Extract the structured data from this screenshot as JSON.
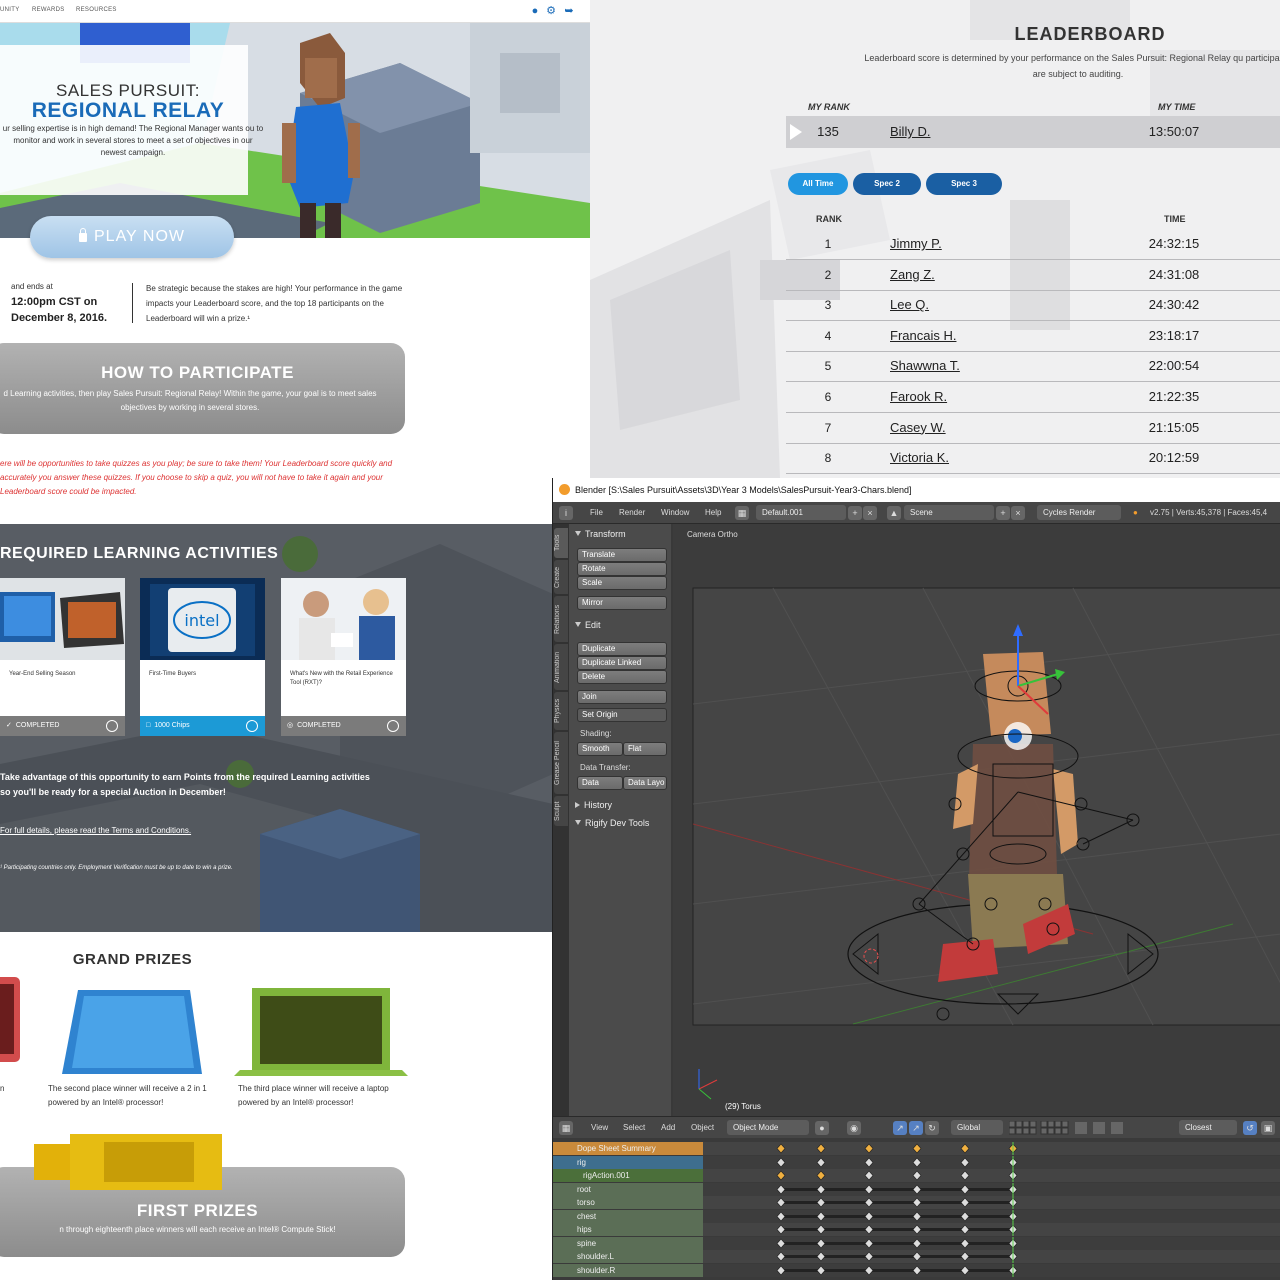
{
  "campaign": {
    "nav": {
      "items": [
        "UNITY",
        "REWARDS",
        "RESOURCES"
      ]
    },
    "hero": {
      "title_line1": "SALES PURSUIT:",
      "title_line2": "REGIONAL RELAY",
      "description": "ur selling expertise is in high demand! The Regional Manager wants ou to monitor and work in several stores to meet a set of objectives in our newest campaign.",
      "play_label": "PLAY NOW"
    },
    "schedule": {
      "prefix": "and ends at",
      "time": "12:00pm CST on",
      "date": "December 8, 2016.",
      "strategic": "Be strategic because the stakes are high! Your performance in the game impacts your Leaderboard score, and the top 18 participants on the Leaderboard will win a prize.¹"
    },
    "how_to": {
      "title": "HOW TO PARTICIPATE",
      "description": "d Learning activities, then play Sales Pursuit: Regional Relay! Within the game, your goal is to meet sales objectives by working in several stores."
    },
    "quiz_note": "ere will be opportunities to take quizzes as you play; be sure to take them! Your Leaderboard score quickly and accurately you answer these quizzes. If you choose to skip a quiz, you will not have to take it again and your Leaderboard score could be impacted.",
    "required": {
      "title": "REQUIRED LEARNING ACTIVITIES",
      "cards": [
        {
          "label": "Year-End Selling Season",
          "status": "COMPLETED",
          "color": "#7b7b7b"
        },
        {
          "label": "First-Time Buyers",
          "status": "1000 Chips",
          "color": "#1c9ad6"
        },
        {
          "label": "What's New with the Retail Experience Tool (RXT)?",
          "status": "COMPLETED",
          "color": "#7b7b7b"
        }
      ],
      "intel_logo_text": "intel",
      "advantage": "Take advantage of this opportunity to earn Points from the required Learning activities so you'll be ready for a special Auction in December!",
      "terms": "For full details, please read the Terms and Conditions.",
      "participating": "¹ Participating countries only. Employment Verification must be up to date to win a prize."
    },
    "prizes": {
      "grand_title": "GRAND PRIZES",
      "first_partial": "n",
      "second": "The second place winner will receive a 2 in 1 powered by an Intel® processor!",
      "third": "The third place winner will receive a laptop powered by an Intel® processor!",
      "first_title": "FIRST PRIZES",
      "first_desc": "n through eighteenth place winners will each receive an Intel® Compute Stick!"
    }
  },
  "leaderboard": {
    "title": "LEADERBOARD",
    "description": "Leaderboard score is determined by your performance on the Sales Pursuit: Regional Relay qu participants are subject to auditing.",
    "my_rank_label": "MY RANK",
    "my_time_label": "MY TIME",
    "me": {
      "rank": "135",
      "name": "Billy D.",
      "time": "13:50:07"
    },
    "filters": [
      {
        "label": "All Time",
        "color": "#2196e0"
      },
      {
        "label": "Spec 2",
        "color": "#1a5fa3"
      },
      {
        "label": "Spec 3",
        "color": "#1a5fa3"
      }
    ],
    "rank_header": "RANK",
    "time_header": "TIME",
    "rows": [
      {
        "rank": "1",
        "name": "Jimmy P.",
        "time": "24:32:15"
      },
      {
        "rank": "2",
        "name": "Zang Z.",
        "time": "24:31:08"
      },
      {
        "rank": "3",
        "name": "Lee Q.",
        "time": "24:30:42"
      },
      {
        "rank": "4",
        "name": "Francais H.",
        "time": "23:18:17"
      },
      {
        "rank": "5",
        "name": "Shawwna T.",
        "time": "22:00:54"
      },
      {
        "rank": "6",
        "name": "Farook R.",
        "time": "21:22:35"
      },
      {
        "rank": "7",
        "name": "Casey W.",
        "time": "21:15:05"
      },
      {
        "rank": "8",
        "name": "Victoria K.",
        "time": "20:12:59"
      }
    ]
  },
  "blender": {
    "title": "Blender [S:\\Sales Pursuit\\Assets\\3D\\Year 3 Models\\SalesPursuit-Year3-Chars.blend]",
    "menu": [
      "File",
      "Render",
      "Window",
      "Help"
    ],
    "screen_layout": "Default.001",
    "scene": "Scene",
    "engine": "Cycles Render",
    "stats": "v2.75 | Verts:45,378 | Faces:45,4",
    "tabs": [
      "Tools",
      "Create",
      "Relations",
      "Animation",
      "Physics",
      "Grease Pencil",
      "Sculpt"
    ],
    "tool": {
      "transform": "Transform",
      "translate": "Translate",
      "rotate": "Rotate",
      "scale": "Scale",
      "mirror": "Mirror",
      "edit": "Edit",
      "duplicate": "Duplicate",
      "duplicate_linked": "Duplicate Linked",
      "delete": "Delete",
      "join": "Join",
      "set_origin": "Set Origin",
      "shading": "Shading:",
      "smooth": "Smooth",
      "flat": "Flat",
      "data_transfer": "Data Transfer:",
      "data": "Data",
      "data_layo": "Data Layo",
      "history": "History",
      "rigify": "Rigify Dev Tools"
    },
    "viewport": {
      "camera_label": "Camera Ortho",
      "object_label": "(29) Torus"
    },
    "bottom_menu": [
      "View",
      "Select",
      "Add",
      "Object"
    ],
    "mode": "Object Mode",
    "orientation": "Global",
    "snap": "Closest",
    "dope": {
      "summary": "Dope Sheet Summary",
      "rig": "rig",
      "action": "rigAction.001",
      "bones": [
        "root",
        "torso",
        "chest",
        "hips",
        "spine",
        "shoulder.L",
        "shoulder.R"
      ]
    }
  }
}
